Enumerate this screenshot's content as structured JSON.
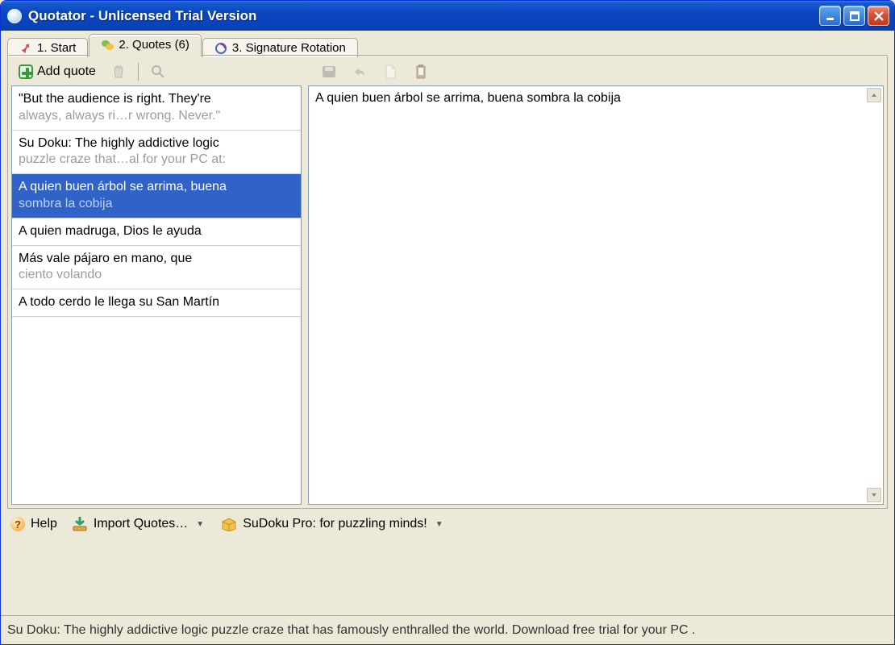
{
  "window": {
    "title": "Quotator - Unlicensed Trial Version"
  },
  "tabs": [
    {
      "label": "1. Start"
    },
    {
      "label": "2. Quotes (6)"
    },
    {
      "label": "3. Signature Rotation"
    }
  ],
  "toolbar": {
    "add_quote_label": "Add quote"
  },
  "quotes": [
    {
      "line1": "\"But the audience is right. They're",
      "line2": "always, always ri…r wrong. Never.\"",
      "selected": false,
      "single": false
    },
    {
      "line1": "Su Doku: The highly addictive logic",
      "line2": "puzzle craze that…al for your PC at:",
      "selected": false,
      "single": false
    },
    {
      "line1": "A quien buen árbol se arrima, buena",
      "line2": "sombra la cobija",
      "selected": true,
      "single": false
    },
    {
      "line1": "A quien madruga, Dios le ayuda",
      "line2": "",
      "selected": false,
      "single": true
    },
    {
      "line1": "Más vale pájaro en mano, que",
      "line2": "ciento volando",
      "selected": false,
      "single": false
    },
    {
      "line1": "A todo cerdo le llega su San Martín",
      "line2": "",
      "selected": false,
      "single": true
    }
  ],
  "editor": {
    "content": "A quien buen árbol se arrima, buena sombra la cobija"
  },
  "bottom": {
    "help_label": "Help",
    "import_label": "Import Quotes…",
    "sudoku_label": "SuDoku Pro: for puzzling minds!"
  },
  "status": {
    "text": "Su Doku: The highly addictive logic puzzle craze that has famously enthralled the world. Download free trial for your PC ."
  }
}
